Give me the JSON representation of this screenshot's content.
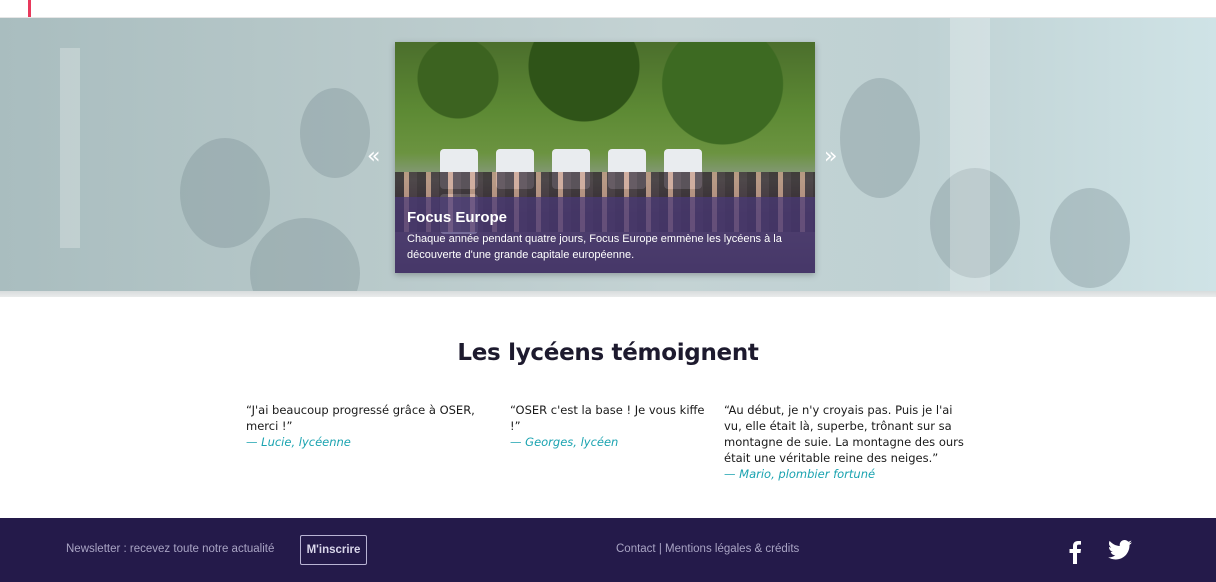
{
  "hero": {
    "slide": {
      "title": "Focus Europe",
      "text": "Chaque année pendant quatre jours, Focus Europe emmène les lycéens à la découverte d'une grande capitale européenne."
    },
    "prev_arrow": "«",
    "next_arrow": "»"
  },
  "testimonials": {
    "title": "Les lycéens témoignent",
    "items": [
      {
        "quote": "“J'ai beaucoup progressé grâce à OSER, merci !”",
        "author": "— Lucie, lycéenne"
      },
      {
        "quote": "“OSER c'est la base ! Je vous kiffe !”",
        "author": "— Georges, lycéen"
      },
      {
        "quote": "“Au début, je n'y croyais pas. Puis je l'ai vu, elle était là, superbe, trônant sur sa montagne de suie. La montagne des ours était une véritable reine des neiges.”",
        "author": "— Mario, plombier fortuné"
      }
    ]
  },
  "footer": {
    "newsletter_text": "Newsletter : recevez toute notre actualité",
    "subscribe_label": "M'inscrire",
    "contact_label": "Contact",
    "separator": " | ",
    "legal_label": "Mentions légales & crédits",
    "facebook_icon": "facebook-icon",
    "twitter_icon": "twitter-icon"
  },
  "colors": {
    "footer_bg": "#241a4a",
    "accent": "#e8395c",
    "author": "#1aa3b0",
    "caption_bg": "#4a3a78"
  }
}
